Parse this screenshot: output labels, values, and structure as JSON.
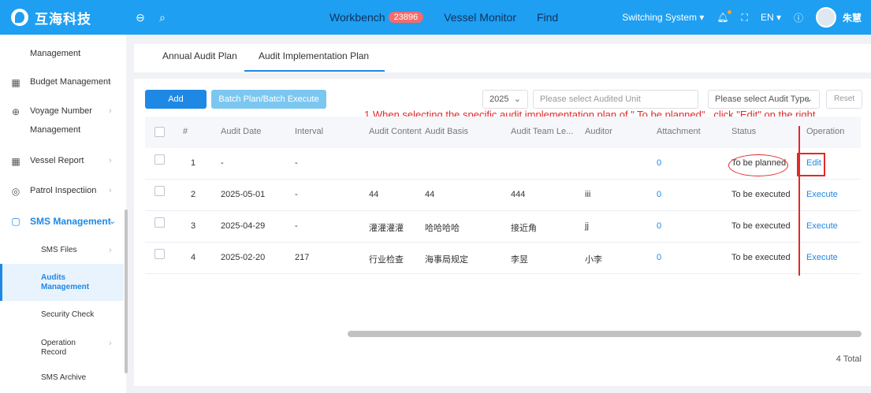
{
  "header": {
    "app_name": "互海科技",
    "nav": [
      {
        "label": "Workbench",
        "badge": "23896"
      },
      {
        "label": "Vessel Monitor"
      },
      {
        "label": "Find"
      }
    ],
    "switch_system": "Switching System",
    "lang": "EN",
    "user": "朱慧",
    "icons": [
      "back-icon",
      "search-icon",
      "bell-icon",
      "fullscreen-icon",
      "help-icon"
    ]
  },
  "sidebar": {
    "items": [
      {
        "label": "Management",
        "icon": ""
      },
      {
        "label": "Budget Management",
        "icon": "budget-icon"
      },
      {
        "label": "Voyage Number",
        "label2": "Management",
        "icon": "globe-icon"
      },
      {
        "label": "Vessel Report",
        "icon": "calendar-icon"
      },
      {
        "label": "Patrol Inspectiion",
        "icon": "check-circle-icon"
      },
      {
        "label": "SMS Management",
        "icon": "document-icon"
      }
    ],
    "sub_items": [
      {
        "label": "SMS Files"
      },
      {
        "label": "Audits",
        "label2": "Management"
      },
      {
        "label": "Security Check"
      },
      {
        "label": "Operation",
        "label2": "Record"
      },
      {
        "label": "SMS Archive"
      }
    ]
  },
  "tabs": [
    "Annual Audit Plan",
    "Audit Implementation Plan"
  ],
  "toolbar": {
    "add_label": "Add",
    "batch_label": "Batch Plan/Batch Execute",
    "year": "2025",
    "unit_placeholder": "Please select Audited Unit",
    "type_placeholder": "Please select Audit Type",
    "reset_label": "Reset"
  },
  "annotation": "1.When selecting the specific audit implementation plan of \" To be planned\" , click \"Edit\" on the right",
  "table": {
    "columns": [
      "#",
      "Audit Date",
      "Interval",
      "Audit Content",
      "Audit Basis",
      "Audit Team Le...",
      "Auditor",
      "Attachment",
      "Status",
      "Operation"
    ],
    "rows": [
      {
        "no": "1",
        "date": "-",
        "interval": "-",
        "content": "",
        "basis": "",
        "leader": "",
        "auditor": "",
        "attachment": "0",
        "status": "To be planned",
        "op": "Edit"
      },
      {
        "no": "2",
        "date": "2025-05-01",
        "interval": "-",
        "content": "44",
        "basis": "44",
        "leader": "444",
        "auditor": "iii",
        "attachment": "0",
        "status": "To be executed",
        "op": "Execute"
      },
      {
        "no": "3",
        "date": "2025-04-29",
        "interval": "-",
        "content": "灌灌灌灌",
        "basis": "哈哈哈哈",
        "leader": "接近角",
        "auditor": "jj",
        "attachment": "0",
        "status": "To be executed",
        "op": "Execute"
      },
      {
        "no": "4",
        "date": "2025-02-20",
        "interval": "217",
        "content": "行业检查",
        "basis": "海事局规定",
        "leader": "李昱",
        "auditor": "小李",
        "attachment": "0",
        "status": "To be executed",
        "op": "Execute"
      }
    ]
  },
  "footer": {
    "total": "4 Total"
  },
  "colors": {
    "accent": "#1e88e5",
    "header": "#1e9ff2",
    "annotation": "#e02a2a"
  }
}
